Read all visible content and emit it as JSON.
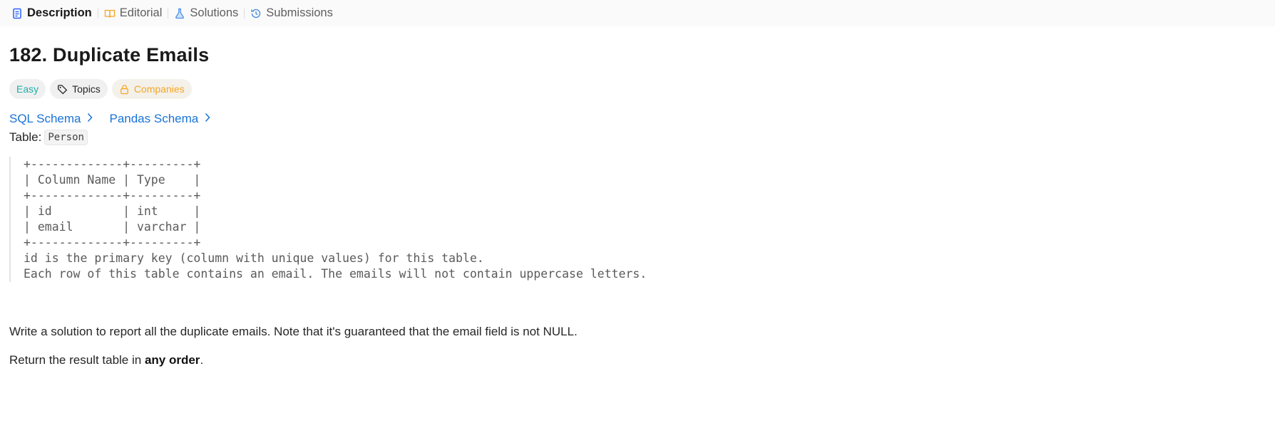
{
  "tabs": [
    {
      "label": "Description",
      "icon": "description-icon",
      "active": true
    },
    {
      "label": "Editorial",
      "icon": "book-icon",
      "active": false
    },
    {
      "label": "Solutions",
      "icon": "flask-icon",
      "active": false
    },
    {
      "label": "Submissions",
      "icon": "history-icon",
      "active": false
    }
  ],
  "problem": {
    "title": "182. Duplicate Emails",
    "difficulty": "Easy",
    "topics_label": "Topics",
    "companies_label": "Companies",
    "sql_schema": "SQL Schema",
    "pandas_schema": "Pandas Schema",
    "table_prefix": "Table:",
    "table_name": "Person",
    "schema_block": "+-------------+---------+\n| Column Name | Type    |\n+-------------+---------+\n| id          | int     |\n| email       | varchar |\n+-------------+---------+\nid is the primary key (column with unique values) for this table.\nEach row of this table contains an email. The emails will not contain uppercase letters.",
    "statement": "Write a solution to report all the duplicate emails. Note that it's guaranteed that the email field is not NULL.",
    "return_prefix": "Return the result table in ",
    "return_bold": "any order",
    "return_suffix": "."
  },
  "colors": {
    "easy": "#1fb0a8",
    "link": "#1a73d6",
    "companies": "#f5a623",
    "tab_icon_active": "#2962ff",
    "tab_icon_editorial": "#f5a623",
    "tab_icon_solutions": "#4a90e2",
    "tab_icon_submissions": "#4a90e2"
  }
}
